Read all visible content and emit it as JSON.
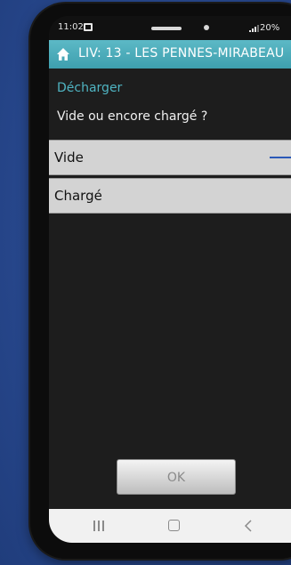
{
  "status_bar": {
    "time": "11:02",
    "battery": "20%"
  },
  "title_bar": {
    "title": "LIV: 13 - LES PENNES-MIRABEAU"
  },
  "content": {
    "section_title": "Décharger",
    "question": "Vide ou encore chargé ?",
    "options": [
      {
        "label": "Vide",
        "selected": true
      },
      {
        "label": "Chargé",
        "selected": false
      }
    ],
    "ok_label": "OK"
  },
  "icons": {
    "home": "home-icon",
    "notification": "notification-icon",
    "signal": "signal-icon",
    "nav_recent": "recent-apps-icon",
    "nav_home": "nav-home-icon",
    "nav_back": "back-icon"
  },
  "colors": {
    "title_bar": "#4aaab8",
    "section_title": "#4fb4c2",
    "option_bg": "#d3d3d3",
    "selection_indicator": "#2b59b8"
  }
}
